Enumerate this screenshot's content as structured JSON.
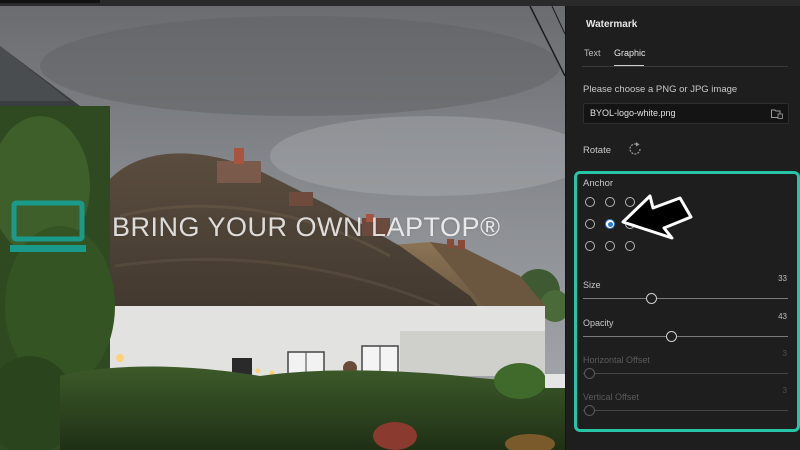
{
  "panel": {
    "title": "Watermark",
    "tabs": [
      {
        "label": "Text",
        "active": false
      },
      {
        "label": "Graphic",
        "active": true
      }
    ],
    "choose_label": "Please choose a PNG or JPG image",
    "file_name": "BYOL-logo-white.png",
    "rotate_label": "Rotate",
    "anchor": {
      "label": "Anchor",
      "grid_rows": 3,
      "grid_cols": 3,
      "selected": "middle-center"
    },
    "sliders": [
      {
        "id": "size",
        "label": "Size",
        "value": "33",
        "fraction": 0.33,
        "enabled": true
      },
      {
        "id": "opacity",
        "label": "Opacity",
        "value": "43",
        "fraction": 0.43,
        "enabled": true
      },
      {
        "id": "horizontal-offset",
        "label": "Horizontal Offset",
        "value": "3",
        "fraction": 0.03,
        "enabled": false
      },
      {
        "id": "vertical-offset",
        "label": "Vertical Offset",
        "value": "3",
        "fraction": 0.03,
        "enabled": false
      }
    ],
    "highlight_color": "#26c4a6"
  },
  "watermark": {
    "text": "BRING YOUR OWN LAPTOP®",
    "logo_color": "#1a9a8a"
  },
  "icons": {
    "folder": "folder-browse-icon",
    "rotate": "rotate-icon",
    "pointer": "pointer-arrow-icon"
  }
}
